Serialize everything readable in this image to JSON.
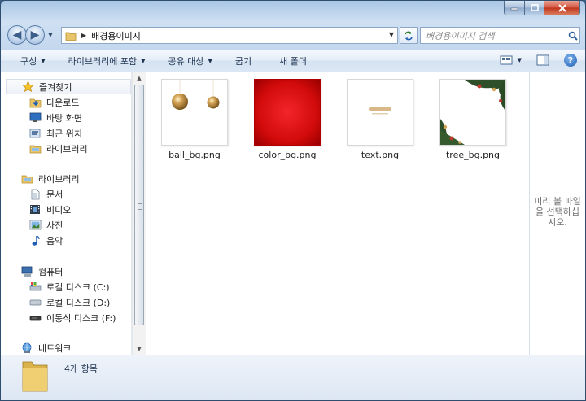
{
  "window": {
    "caption_buttons": [
      "minimize-icon",
      "maximize-icon",
      "close-icon"
    ]
  },
  "address": {
    "path": "배경용이미지",
    "search_placeholder": "배경용이미지 검색"
  },
  "toolbar": {
    "organize": "구성",
    "include_library": "라이브러리에 포함",
    "share_with": "공유 대상",
    "burn": "굽기",
    "new_folder": "새 폴더"
  },
  "sidebar": {
    "favorites": {
      "label": "즐겨찾기",
      "items": [
        "다운로드",
        "바탕 화면",
        "최근 위치",
        "라이브러리"
      ]
    },
    "libraries": {
      "label": "라이브러리",
      "items": [
        "문서",
        "비디오",
        "사진",
        "음악"
      ]
    },
    "computer": {
      "label": "컴퓨터",
      "items": [
        "로컬 디스크 (C:)",
        "로컬 디스크 (D:)",
        "이동식 디스크 (F:)"
      ]
    },
    "network": {
      "label": "네트워크"
    }
  },
  "files": [
    {
      "name": "ball_bg.png",
      "thumb": "gold-ornaments"
    },
    {
      "name": "color_bg.png",
      "thumb": "red-radial"
    },
    {
      "name": "text.png",
      "thumb": "christmas-text"
    },
    {
      "name": "tree_bg.png",
      "thumb": "pine-corner"
    }
  ],
  "preview": {
    "message": "미리 볼 파일을 선택하십시오."
  },
  "status": {
    "item_count": "4개 항목"
  },
  "colors": {
    "accent": "#2f5f9a",
    "red_thumb": "#d10a0a",
    "gold": "#b88a3c"
  }
}
